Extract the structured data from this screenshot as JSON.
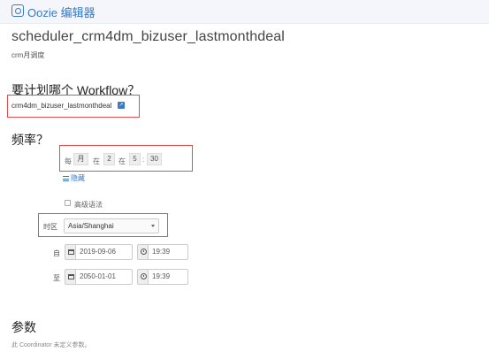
{
  "app": {
    "title": "Oozie 编辑器",
    "accent_color": "#3a79c4",
    "icon": "oozie-logo-icon"
  },
  "coordinator": {
    "name": "scheduler_crm4dm_bizuser_lastmonthdeal",
    "description": "crm月调度"
  },
  "workflow": {
    "heading": "要计划哪个 Workflow？",
    "name": "crm4dm_bizuser_lastmonthdeal",
    "link_icon": "external-link-icon"
  },
  "frequency": {
    "heading": "频率？",
    "every_label": "每",
    "unit_value": "月",
    "at_label_1": "在",
    "day_value": "2",
    "at_label_2": "在",
    "hour_value": "5",
    "separator": ":",
    "minute_value": "30",
    "hide_label": "隐藏",
    "advanced_label": "高级语法",
    "advanced_checked": false
  },
  "timezone": {
    "label": "时区",
    "value": "Asia/Shanghai"
  },
  "start": {
    "label": "自",
    "date": "2019-09-06",
    "time": "19:39"
  },
  "end": {
    "label": "至",
    "date": "2050-01-01",
    "time": "19:39"
  },
  "parameters": {
    "heading": "参数",
    "empty_text": "此 Coordinator 未定义参数。"
  },
  "highlight_color": "#e05050"
}
